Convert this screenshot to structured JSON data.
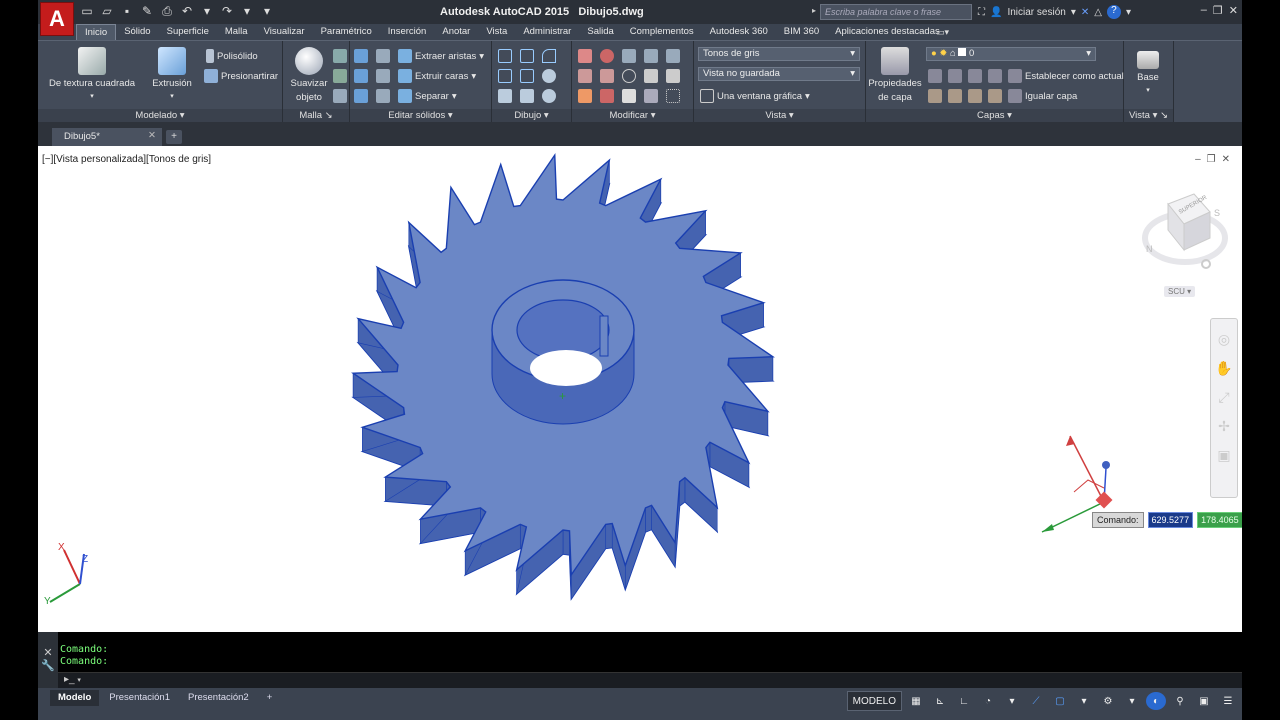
{
  "app": {
    "logo": "A",
    "title": "Autodesk AutoCAD 2015",
    "document": "Dibujo5.dwg",
    "search_placeholder": "Escriba palabra clave o frase",
    "sign_in": "Iniciar sesión"
  },
  "ribbon_tabs": [
    "Inicio",
    "Sólido",
    "Superficie",
    "Malla",
    "Visualizar",
    "Paramétrico",
    "Inserción",
    "Anotar",
    "Vista",
    "Administrar",
    "Salida",
    "Complementos",
    "Autodesk 360",
    "BIM 360",
    "Aplicaciones destacadas"
  ],
  "panels": {
    "modelado": {
      "title": "Modelado",
      "box": "De textura cuadrada",
      "extrude": "Extrusión",
      "polysolid": "Polisólido",
      "presspull": "Presionartirar"
    },
    "malla": {
      "title": "Malla",
      "smooth_line1": "Suavizar",
      "smooth_line2": "objeto"
    },
    "editar_solidos": {
      "title": "Editar sólidos",
      "extract_edges": "Extraer aristas",
      "extrude_faces": "Extruir caras",
      "separate": "Separar"
    },
    "dibujo": {
      "title": "Dibujo"
    },
    "modificar": {
      "title": "Modificar"
    },
    "vista": {
      "title": "Vista",
      "visual_style": "Tonos de gris",
      "named_view": "Vista no guardada",
      "viewport_config": "Una ventana gráfica"
    },
    "capas": {
      "title": "Capas",
      "props_line1": "Propiedades",
      "props_line2": "de capa",
      "current_layer": "0",
      "set_current": "Establecer como actual",
      "match_layer": "Igualar capa"
    },
    "base": {
      "title": "Vista",
      "base": "Base"
    }
  },
  "file_tab": "Dibujo5*",
  "viewport": {
    "label": "[−][Vista personalizada][Tonos de gris]",
    "ucs_menu": "SCU",
    "viewcube_face": "SUPERIOR",
    "compass": {
      "north": "N",
      "south": "S"
    },
    "cmd_tip_label": "Comando:",
    "coord_x": "629.5277",
    "coord_y": "178.4065",
    "shade_color": "#6b87c6",
    "edge_color": "#1a3fb0"
  },
  "command": {
    "history": [
      "Comando:",
      "Comando:"
    ],
    "prompt_icon": "▸_"
  },
  "layout_tabs": [
    "Modelo",
    "Presentación1",
    "Presentación2"
  ],
  "status": {
    "model_label": "MODELO"
  }
}
